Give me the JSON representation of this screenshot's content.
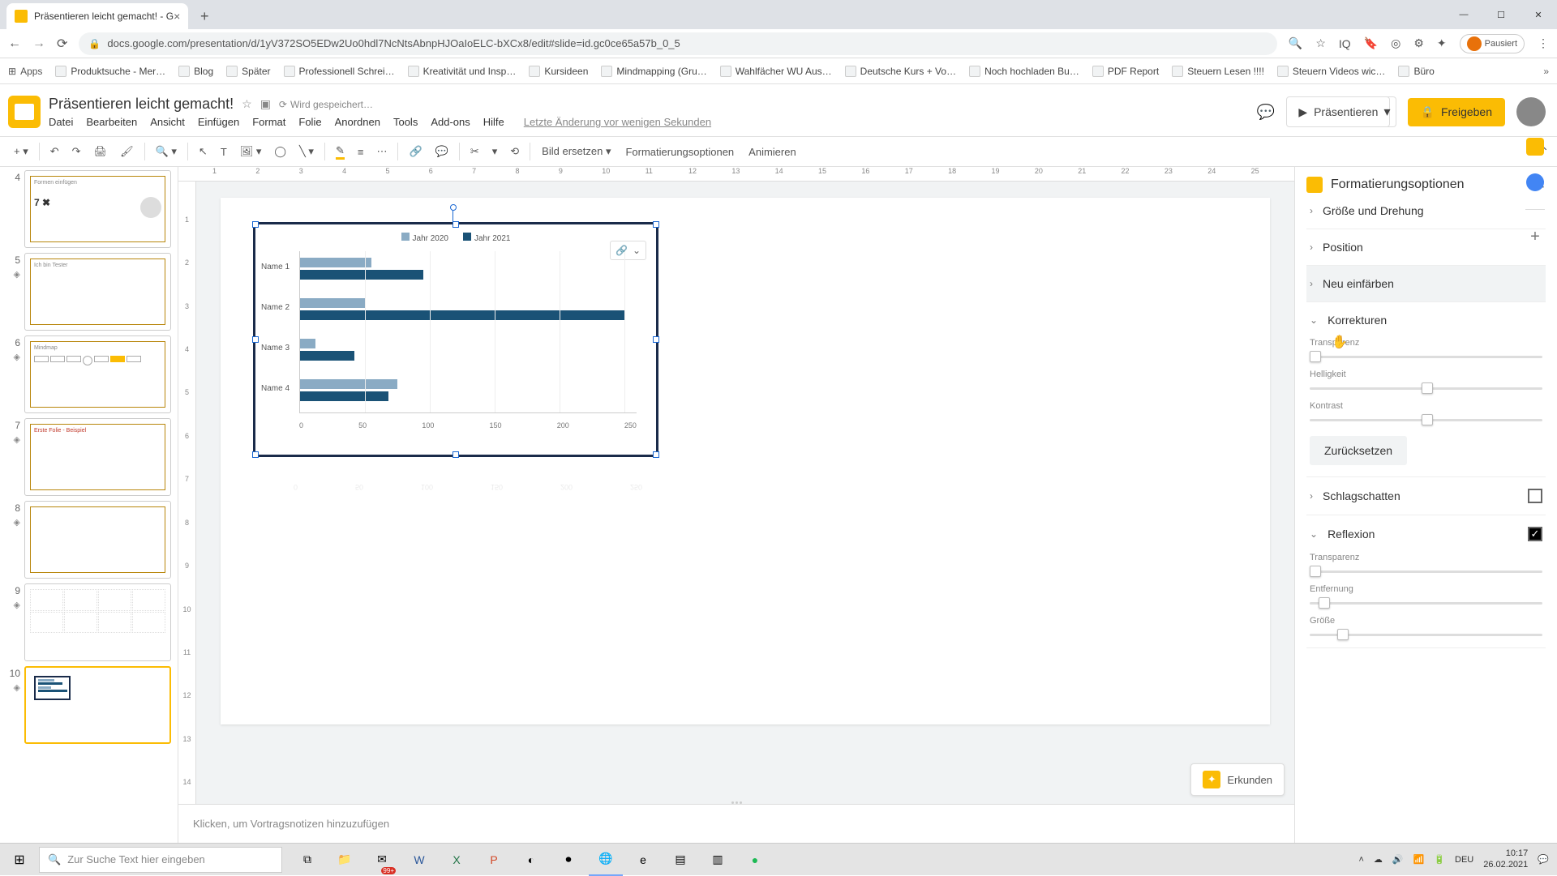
{
  "browser": {
    "tab_title": "Präsentieren leicht gemacht! - G",
    "url": "docs.google.com/presentation/d/1yV372SO5EDw2Uo0hdl7NcNtsAbnpHJOaIoELC-bXCx8/edit#slide=id.gc0ce65a57b_0_5",
    "account_state": "Pausiert",
    "bookmarks": [
      "Apps",
      "Produktsuche - Mer…",
      "Blog",
      "Später",
      "Professionell Schrei…",
      "Kreativität und Insp…",
      "Kursideen",
      "Mindmapping (Gru…",
      "Wahlfächer WU Aus…",
      "Deutsche Kurs + Vo…",
      "Noch hochladen Bu…",
      "PDF Report",
      "Steuern Lesen !!!!",
      "Steuern Videos wic…",
      "Büro"
    ]
  },
  "doc": {
    "title": "Präsentieren leicht gemacht!",
    "saving": "Wird gespeichert…",
    "last_edit": "Letzte Änderung vor wenigen Sekunden",
    "menus": [
      "Datei",
      "Bearbeiten",
      "Ansicht",
      "Einfügen",
      "Format",
      "Folie",
      "Anordnen",
      "Tools",
      "Add-ons",
      "Hilfe"
    ]
  },
  "header_buttons": {
    "present": "Präsentieren",
    "share": "Freigeben"
  },
  "toolbar": {
    "replace_image": "Bild ersetzen",
    "format_options": "Formatierungsoptionen",
    "animate": "Animieren"
  },
  "ruler_h": [
    "1",
    "2",
    "3",
    "4",
    "5",
    "6",
    "7",
    "8",
    "9",
    "10",
    "11",
    "12",
    "13",
    "14",
    "15",
    "16",
    "17",
    "18",
    "19",
    "20",
    "21",
    "22",
    "23",
    "24",
    "25"
  ],
  "ruler_v": [
    "1",
    "2",
    "3",
    "4",
    "5",
    "6",
    "7",
    "8",
    "9",
    "10",
    "11",
    "12",
    "13",
    "14"
  ],
  "slides": [
    {
      "num": "4",
      "label": "Formen einfügen",
      "extra": "7 ✖"
    },
    {
      "num": "5",
      "label": "Ich bin Tester"
    },
    {
      "num": "6",
      "label": "Mindmap"
    },
    {
      "num": "7",
      "label": "Erste Folie - Beispiel"
    },
    {
      "num": "8",
      "label": ""
    },
    {
      "num": "9",
      "label": ""
    },
    {
      "num": "10",
      "label": ""
    }
  ],
  "notes_placeholder": "Klicken, um Vortragsnotizen hinzuzufügen",
  "erkunden": "Erkunden",
  "sidebar": {
    "title": "Formatierungsoptionen",
    "sections": {
      "size_rotation": "Größe und Drehung",
      "position": "Position",
      "recolor": "Neu einfärben",
      "adjustments": "Korrekturen",
      "transparency": "Transparenz",
      "brightness": "Helligkeit",
      "contrast": "Kontrast",
      "reset": "Zurücksetzen",
      "shadow": "Schlagschatten",
      "reflection": "Reflexion",
      "refl_transparency": "Transparenz",
      "refl_distance": "Entfernung",
      "refl_size": "Größe"
    }
  },
  "chart_data": {
    "type": "bar",
    "orientation": "horizontal",
    "categories": [
      "Name 1",
      "Name 2",
      "Name 3",
      "Name 4"
    ],
    "series": [
      {
        "name": "Jahr 2020",
        "color": "#8aabc4",
        "values": [
          55,
          50,
          12,
          75
        ]
      },
      {
        "name": "Jahr 2021",
        "color": "#1a5276",
        "values": [
          95,
          250,
          42,
          68
        ]
      }
    ],
    "xlim": [
      0,
      250
    ],
    "x_ticks": [
      0,
      50,
      100,
      150,
      200,
      250
    ]
  },
  "taskbar": {
    "search_placeholder": "Zur Suche Text hier eingeben",
    "lang": "DEU",
    "time": "10:17",
    "date": "26.02.2021",
    "notif": "99+"
  }
}
